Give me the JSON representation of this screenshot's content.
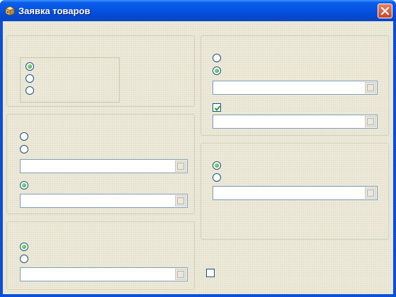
{
  "window": {
    "title": "Заявка товаров"
  },
  "icons": {
    "app": "box-icon",
    "close": "close-icon",
    "combo_button": "ellipsis-button-icon",
    "check": "checkmark-icon"
  },
  "colors": {
    "titlebar": "#0554e3",
    "close_button": "#d4562f",
    "client": "#ece9d8",
    "radio_selected": "#21a121"
  },
  "groups": [
    {
      "id": "grp1",
      "radios": [
        {
          "checked": true
        },
        {
          "checked": false
        },
        {
          "checked": false
        }
      ]
    },
    {
      "id": "grp2",
      "radios": [
        {
          "checked": false
        },
        {
          "checked": false
        }
      ],
      "radios2": [
        {
          "checked": true
        }
      ]
    },
    {
      "id": "grp3",
      "radios": [
        {
          "checked": true
        },
        {
          "checked": false
        }
      ]
    },
    {
      "id": "grp4",
      "radios": [
        {
          "checked": false
        },
        {
          "checked": true
        }
      ],
      "checkbox": {
        "checked": true
      }
    },
    {
      "id": "grp5",
      "radios": [
        {
          "checked": true
        },
        {
          "checked": false
        }
      ]
    }
  ],
  "bottom_checkbox": {
    "checked": false
  }
}
